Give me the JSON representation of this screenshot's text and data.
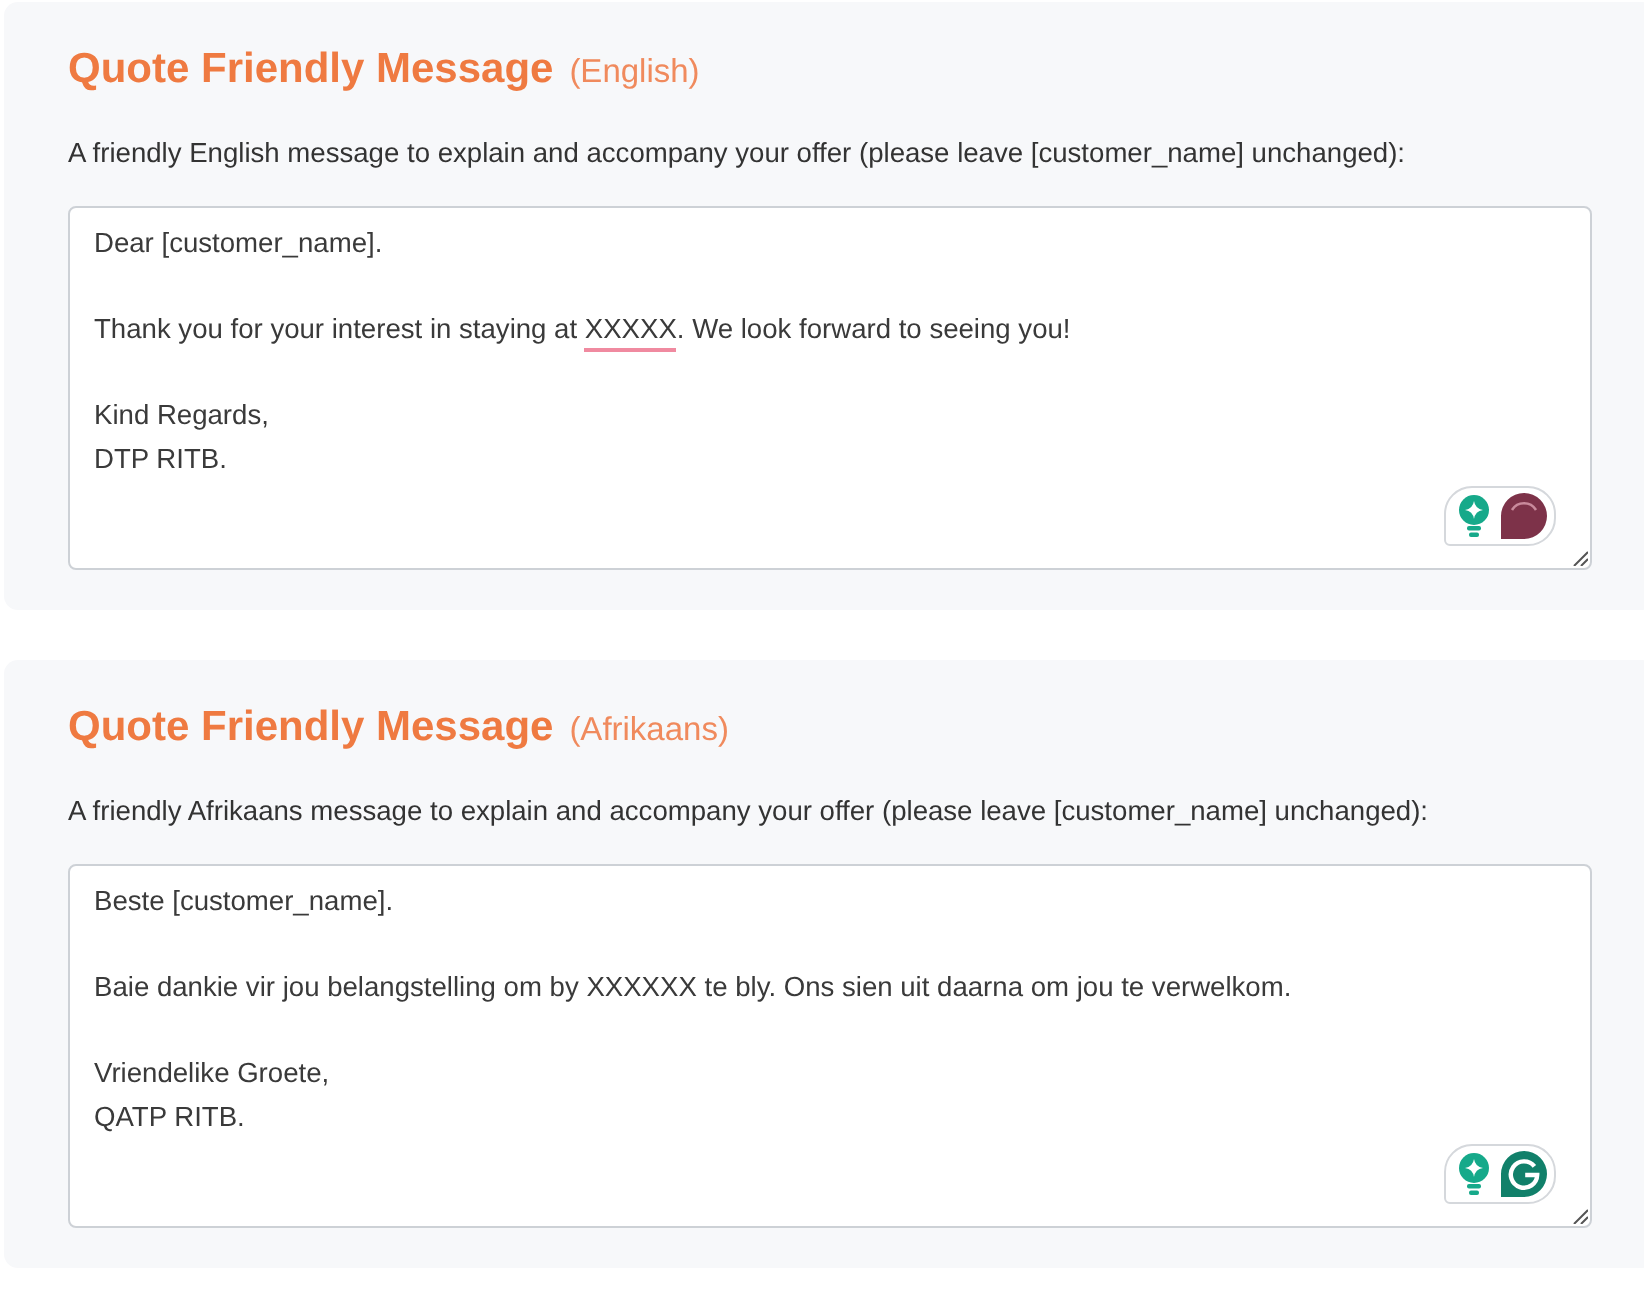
{
  "sections": [
    {
      "title": "Quote Friendly Message",
      "language": "(English)",
      "description": "A friendly English message to explain and accompany your offer (please leave [customer_name] unchanged):",
      "message": {
        "paragraphs": [
          [
            [
              {
                "text": "Dear [customer_name].",
                "misspelled": false
              }
            ]
          ],
          [
            [
              {
                "text": "Thank you for your interest in staying at ",
                "misspelled": false
              },
              {
                "text": "XXXXX",
                "misspelled": true
              },
              {
                "text": ". We look forward to seeing you!",
                "misspelled": false
              }
            ]
          ],
          [
            [
              {
                "text": "Kind Regards,",
                "misspelled": false
              }
            ],
            [
              {
                "text": "DTP RITB.",
                "misspelled": false
              }
            ]
          ]
        ]
      },
      "assistant": {
        "busy": true
      }
    },
    {
      "title": "Quote Friendly Message",
      "language": "(Afrikaans)",
      "description": "A friendly Afrikaans message to explain and accompany your offer (please leave [customer_name] unchanged):",
      "message": {
        "paragraphs": [
          [
            [
              {
                "text": "Beste [customer_name].",
                "misspelled": false
              }
            ]
          ],
          [
            [
              {
                "text": "Baie dankie vir jou belangstelling om by XXXXXX te bly. Ons sien uit daarna om jou te verwelkom.",
                "misspelled": false
              }
            ]
          ],
          [
            [
              {
                "text": "Vriendelike Groete,",
                "misspelled": false
              }
            ],
            [
              {
                "text": "QATP RITB.",
                "misspelled": false
              }
            ]
          ]
        ]
      },
      "assistant": {
        "busy": false
      }
    }
  ]
}
